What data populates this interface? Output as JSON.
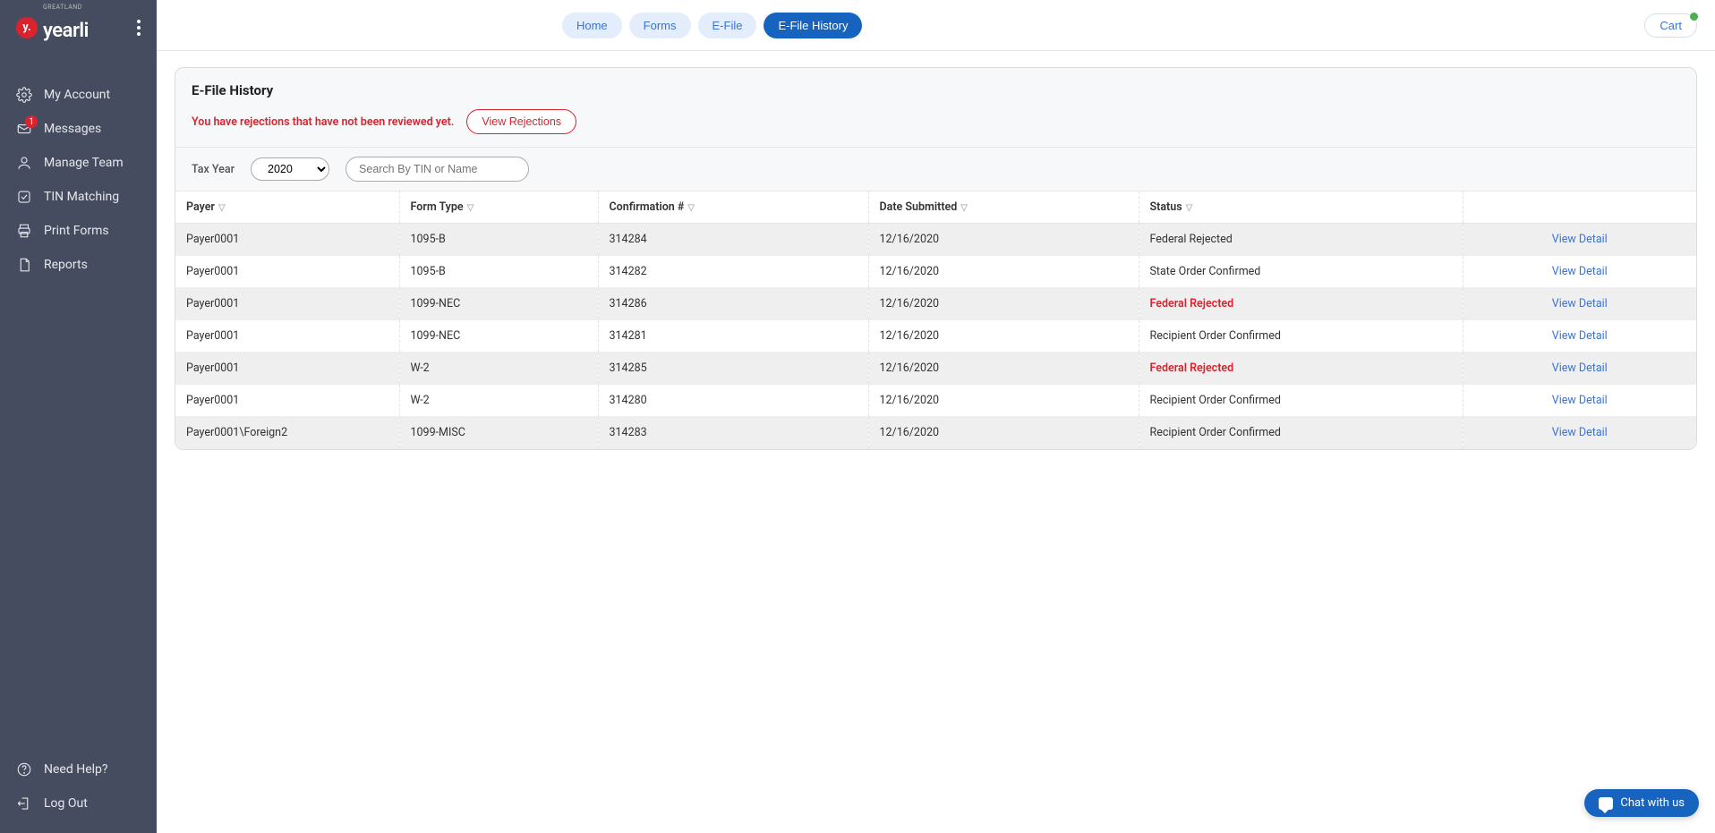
{
  "brand": {
    "badge": "y.",
    "name": "yearli",
    "super": "GREATLAND"
  },
  "sidebar": {
    "items": [
      {
        "label": "My Account",
        "icon": "gear"
      },
      {
        "label": "Messages",
        "icon": "mail",
        "badge": "1"
      },
      {
        "label": "Manage Team",
        "icon": "user"
      },
      {
        "label": "TIN Matching",
        "icon": "check-square"
      },
      {
        "label": "Print Forms",
        "icon": "printer"
      },
      {
        "label": "Reports",
        "icon": "file"
      }
    ],
    "bottom": [
      {
        "label": "Need Help?",
        "icon": "help"
      },
      {
        "label": "Log Out",
        "icon": "logout"
      }
    ]
  },
  "topbar": {
    "tabs": [
      {
        "label": "Home",
        "active": false
      },
      {
        "label": "Forms",
        "active": false
      },
      {
        "label": "E-File",
        "active": false
      },
      {
        "label": "E-File History",
        "active": true
      }
    ],
    "cart_label": "Cart"
  },
  "panel": {
    "title": "E-File History",
    "alert_text": "You have rejections that have not been reviewed yet.",
    "alert_button": "View Rejections",
    "filter_label": "Tax Year",
    "year_value": "2020",
    "search_placeholder": "Search By TIN or Name"
  },
  "table": {
    "columns": [
      "Payer",
      "Form Type",
      "Confirmation #",
      "Date Submitted",
      "Status"
    ],
    "action_label": "View Detail",
    "rows": [
      {
        "payer": "Payer0001",
        "form": "1095-B",
        "conf": "314284",
        "date": "12/16/2020",
        "status": "Federal Rejected",
        "rejected": false
      },
      {
        "payer": "Payer0001",
        "form": "1095-B",
        "conf": "314282",
        "date": "12/16/2020",
        "status": "State Order Confirmed",
        "rejected": false
      },
      {
        "payer": "Payer0001",
        "form": "1099-NEC",
        "conf": "314286",
        "date": "12/16/2020",
        "status": "Federal Rejected",
        "rejected": true
      },
      {
        "payer": "Payer0001",
        "form": "1099-NEC",
        "conf": "314281",
        "date": "12/16/2020",
        "status": "Recipient Order Confirmed",
        "rejected": false
      },
      {
        "payer": "Payer0001",
        "form": "W-2",
        "conf": "314285",
        "date": "12/16/2020",
        "status": "Federal Rejected",
        "rejected": true
      },
      {
        "payer": "Payer0001",
        "form": "W-2",
        "conf": "314280",
        "date": "12/16/2020",
        "status": "Recipient Order Confirmed",
        "rejected": false
      },
      {
        "payer": "Payer0001\\Foreign2",
        "form": "1099-MISC",
        "conf": "314283",
        "date": "12/16/2020",
        "status": "Recipient Order Confirmed",
        "rejected": false
      }
    ]
  },
  "chat": {
    "label": "Chat with us"
  }
}
